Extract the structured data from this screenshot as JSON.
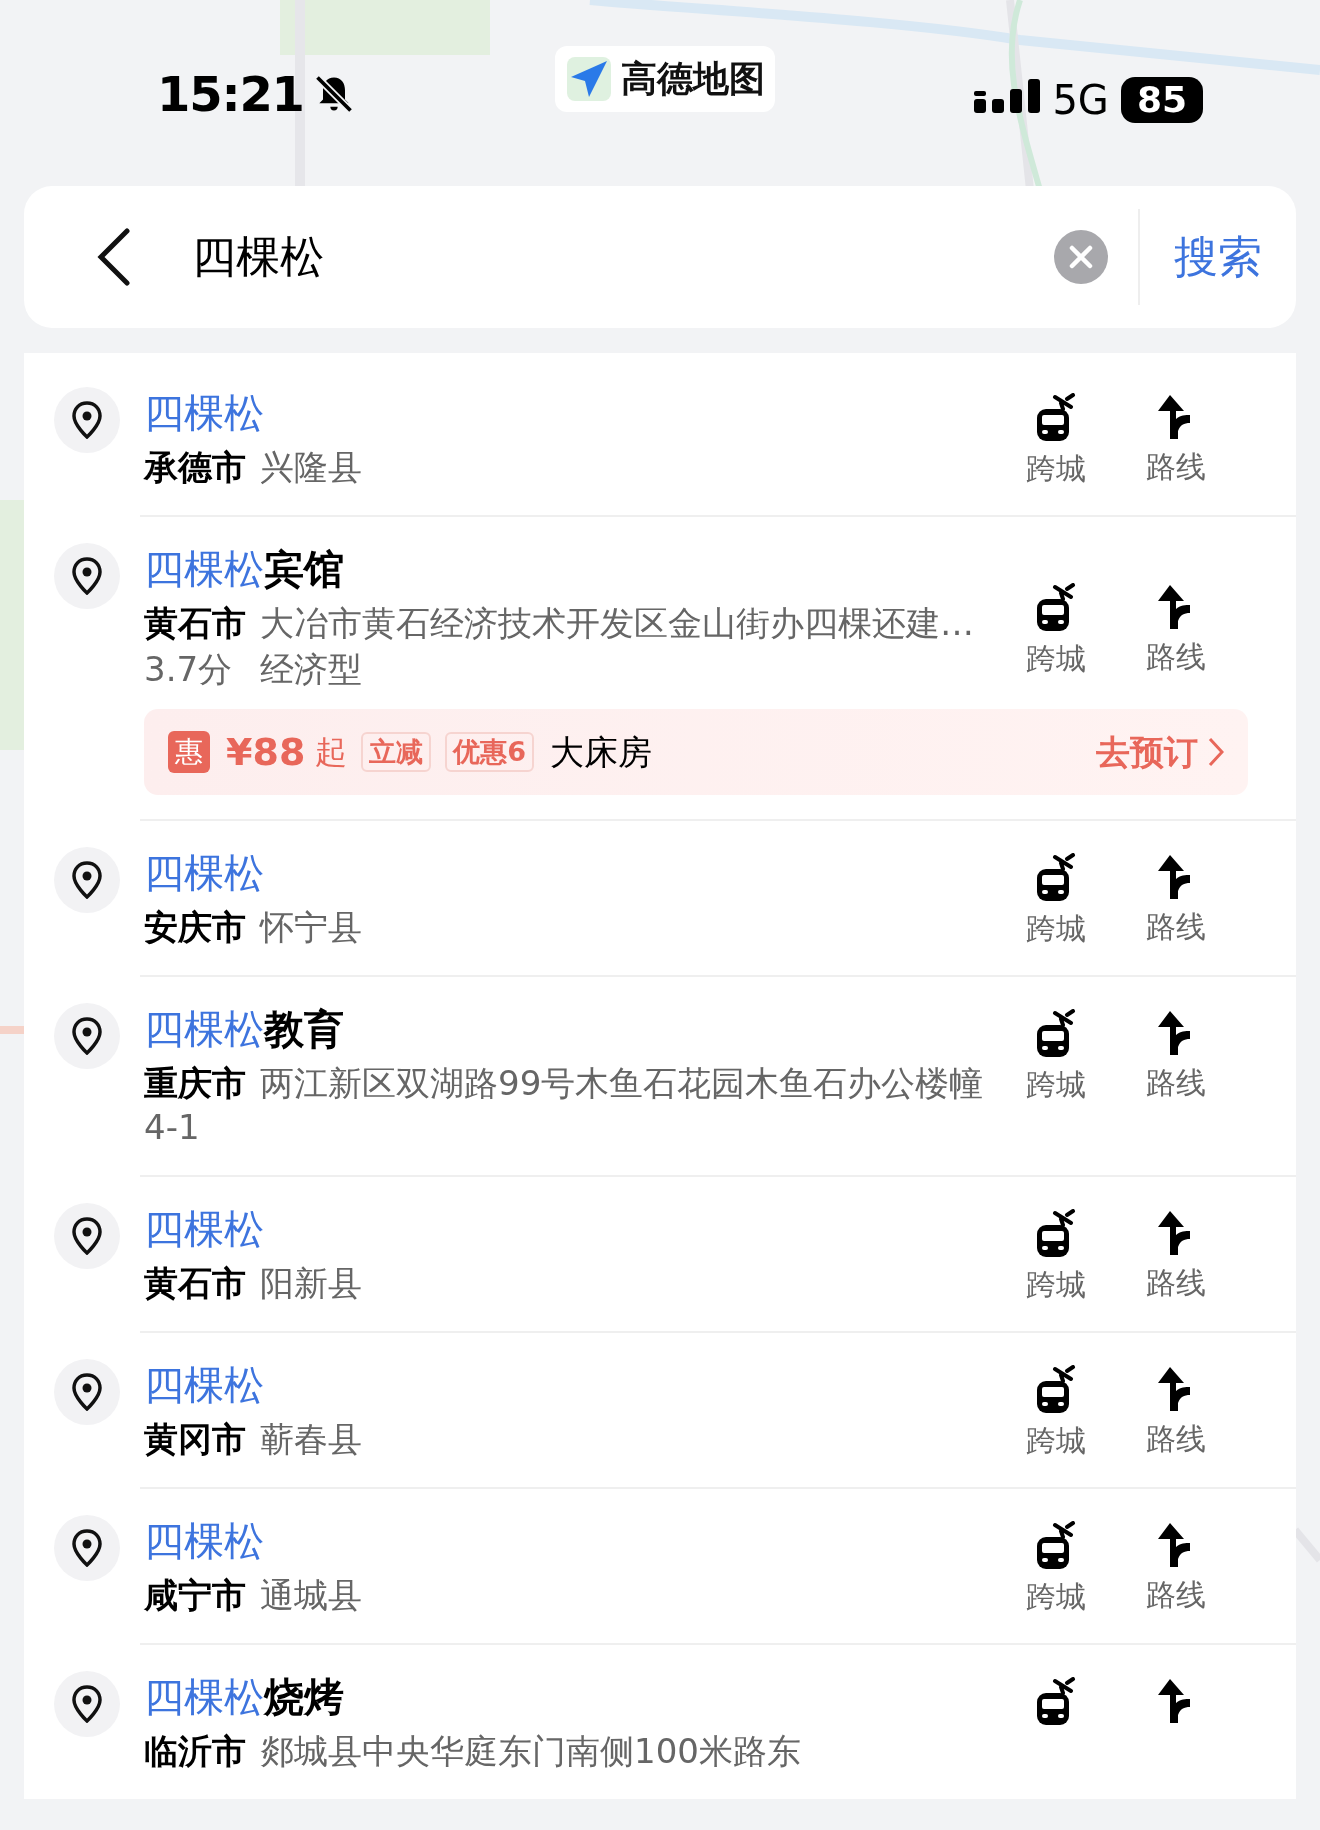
{
  "status_bar": {
    "time": "15:21",
    "network": "5G",
    "battery": "85"
  },
  "app_badge": {
    "label": "高德地图"
  },
  "search": {
    "value": "四棵松",
    "submit": "搜索"
  },
  "results": [
    {
      "match": "四棵松",
      "city": "承德市",
      "district": "兴隆县",
      "actions": [
        {
          "kind": "transit",
          "label": "跨城"
        },
        {
          "kind": "route",
          "label": "路线"
        }
      ]
    },
    {
      "match": "四棵松",
      "rest": "宾馆",
      "city": "黄石市",
      "district": "大冶市黄石经济技术开发区金山街办四棵还建…",
      "rating": "3.7分",
      "category": "经济型",
      "promo": {
        "badge": "惠",
        "price": "¥88",
        "suffix": "起",
        "tags": [
          "立减",
          "优惠6"
        ],
        "room": "大床房",
        "action": "去预订"
      },
      "actions": [
        {
          "kind": "transit",
          "label": "跨城"
        },
        {
          "kind": "route",
          "label": "路线"
        }
      ]
    },
    {
      "match": "四棵松",
      "city": "安庆市",
      "district": "怀宁县",
      "actions": [
        {
          "kind": "transit",
          "label": "跨城"
        },
        {
          "kind": "route",
          "label": "路线"
        }
      ]
    },
    {
      "match": "四棵松",
      "rest": "教育",
      "city": "重庆市",
      "district": "两江新区双湖路99号木鱼石花园木鱼石办公楼幢4-1",
      "actions": [
        {
          "kind": "transit",
          "label": "跨城"
        },
        {
          "kind": "route",
          "label": "路线"
        }
      ]
    },
    {
      "match": "四棵松",
      "city": "黄石市",
      "district": "阳新县",
      "actions": [
        {
          "kind": "transit",
          "label": "跨城"
        },
        {
          "kind": "route",
          "label": "路线"
        }
      ]
    },
    {
      "match": "四棵松",
      "city": "黄冈市",
      "district": "蕲春县",
      "actions": [
        {
          "kind": "transit",
          "label": "跨城"
        },
        {
          "kind": "route",
          "label": "路线"
        }
      ]
    },
    {
      "match": "四棵松",
      "city": "咸宁市",
      "district": "通城县",
      "actions": [
        {
          "kind": "transit",
          "label": "跨城"
        },
        {
          "kind": "route",
          "label": "路线"
        }
      ]
    },
    {
      "match": "四棵松",
      "rest": "烧烤",
      "city": "临沂市",
      "district": "郯城县中央华庭东门南侧100米路东",
      "actions": [
        {
          "kind": "transit"
        },
        {
          "kind": "route"
        }
      ]
    }
  ]
}
